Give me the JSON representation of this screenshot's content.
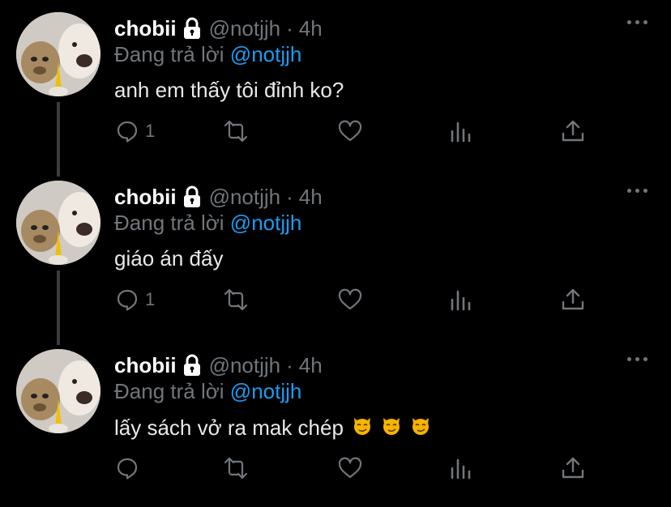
{
  "tweets": [
    {
      "name": "chobii",
      "handle": "@notjjh",
      "separator": "·",
      "time": "4h",
      "replying_prefix": "Đang trả lời",
      "replying_to": "@notjjh",
      "text": "anh em thấy tôi đỉnh ko?",
      "reply_count": "1"
    },
    {
      "name": "chobii",
      "handle": "@notjjh",
      "separator": "·",
      "time": "4h",
      "replying_prefix": "Đang trả lời",
      "replying_to": "@notjjh",
      "text": "giáo án đấy",
      "reply_count": "1"
    },
    {
      "name": "chobii",
      "handle": "@notjjh",
      "separator": "·",
      "time": "4h",
      "replying_prefix": "Đang trả lời",
      "replying_to": "@notjjh",
      "text": "lấy sách vở ra mak chép",
      "reply_count": "",
      "emojis": [
        "smirk-cat-emoji",
        "smirk-cat-emoji",
        "smirk-cat-emoji"
      ]
    }
  ],
  "colors": {
    "background": "#000000",
    "text": "#e7e9ea",
    "secondary": "#71767b",
    "mention": "#1d9bf0",
    "thread_line": "#3a3d40"
  }
}
